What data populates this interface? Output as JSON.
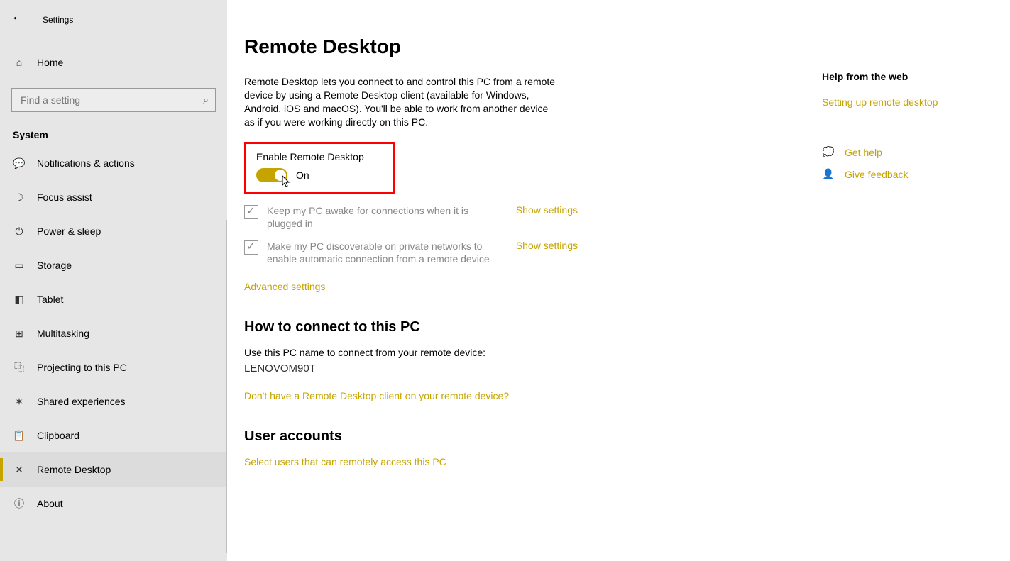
{
  "window": {
    "title": "Settings"
  },
  "sidebar": {
    "home_label": "Home",
    "search_placeholder": "Find a setting",
    "category": "System",
    "items": [
      {
        "label": "Notifications & actions"
      },
      {
        "label": "Focus assist"
      },
      {
        "label": "Power & sleep"
      },
      {
        "label": "Storage"
      },
      {
        "label": "Tablet"
      },
      {
        "label": "Multitasking"
      },
      {
        "label": "Projecting to this PC"
      },
      {
        "label": "Shared experiences"
      },
      {
        "label": "Clipboard"
      },
      {
        "label": "Remote Desktop"
      },
      {
        "label": "About"
      }
    ]
  },
  "main": {
    "title": "Remote Desktop",
    "description": "Remote Desktop lets you connect to and control this PC from a remote device by using a Remote Desktop client (available for Windows, Android, iOS and macOS). You'll be able to work from another device as if you were working directly on this PC.",
    "enable_label": "Enable Remote Desktop",
    "toggle_state": "On",
    "check1": "Keep my PC awake for connections when it is plugged in",
    "check2": "Make my PC discoverable on private networks to enable automatic connection from a remote device",
    "show_settings": "Show settings",
    "advanced": "Advanced settings",
    "how_title": "How to connect to this PC",
    "how_desc": "Use this PC name to connect from your remote device:",
    "pc_name": "LENOVOM90T",
    "no_client": "Don't have a Remote Desktop client on your remote device?",
    "user_title": "User accounts",
    "select_users": "Select users that can remotely access this PC"
  },
  "right": {
    "heading": "Help from the web",
    "setup_link": "Setting up remote desktop",
    "get_help": "Get help",
    "feedback": "Give feedback"
  }
}
